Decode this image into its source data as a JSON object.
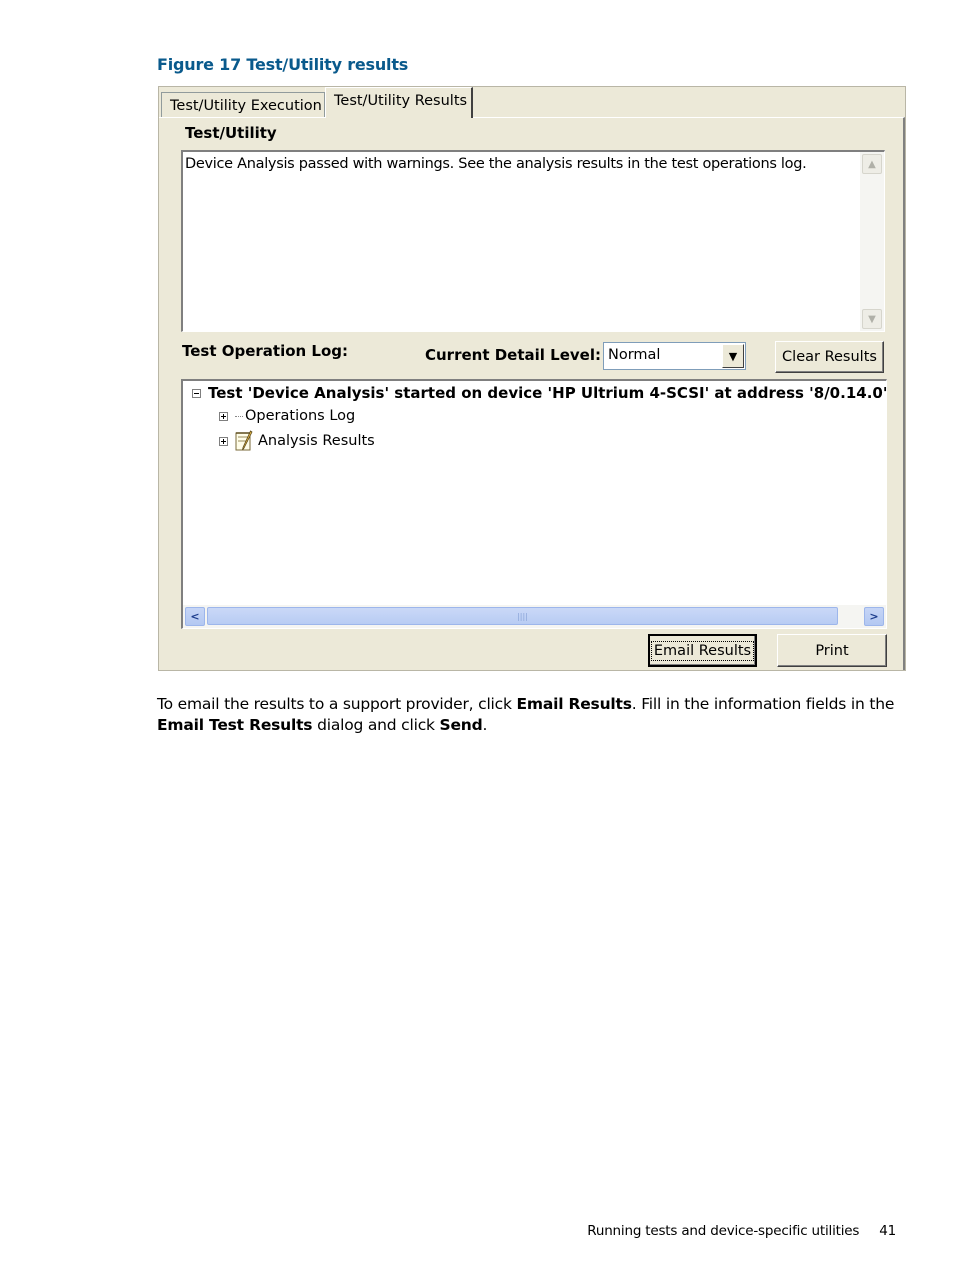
{
  "caption": "Figure 17 Test/Utility results",
  "tabs": {
    "execution": "Test/Utility Execution",
    "results": "Test/Utility Results"
  },
  "test_utility": {
    "heading": "Test/Utility",
    "description": "Device Analysis passed with warnings. See the analysis results in the test operations log."
  },
  "log": {
    "heading": "Test Operation Log:",
    "detail_label": "Current Detail Level:",
    "detail_value": "Normal",
    "clear_button": "Clear Results",
    "root": "Test 'Device Analysis' started on device 'HP Ultrium 4-SCSI' at address '8/0.14.0'",
    "children": [
      "Operations Log",
      "Analysis Results"
    ]
  },
  "buttons": {
    "email": "Email Results",
    "print": "Print"
  },
  "body": {
    "p1": "To email the results to a support provider, click ",
    "b1": "Email Results",
    "p2": ". Fill in the information fields in the ",
    "b2": "Email Test Results",
    "p3": " dialog and click ",
    "b3": "Send",
    "p4": "."
  },
  "footer": {
    "section": "Running tests and device-specific utilities",
    "page": "41"
  }
}
